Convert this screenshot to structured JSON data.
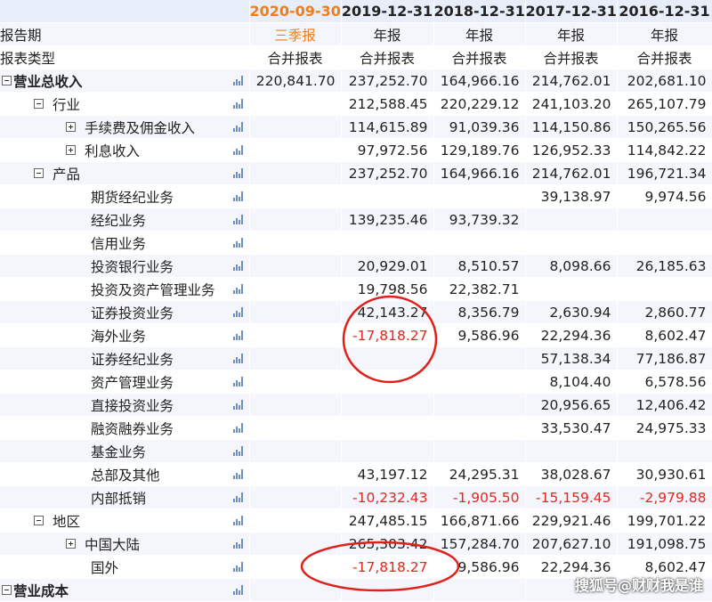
{
  "header": {
    "dates": [
      "2020-09-30",
      "2019-12-31",
      "2018-12-31",
      "2017-12-31",
      "2016-12-31"
    ],
    "active_date": "2020-09-30"
  },
  "meta_rows": [
    {
      "label": "报告期",
      "values": [
        "三季报",
        "年报",
        "年报",
        "年报",
        "年报"
      ]
    },
    {
      "label": "报表类型",
      "values": [
        "合并报表",
        "合并报表",
        "合并报表",
        "合并报表",
        "合并报表"
      ]
    }
  ],
  "rows": [
    {
      "label": "营业总收入",
      "level": 0,
      "expander": "minus",
      "bold": true,
      "values": [
        "220,841.70",
        "237,252.70",
        "164,966.16",
        "214,762.01",
        "202,681.10"
      ]
    },
    {
      "label": "行业",
      "level": 1,
      "expander": "minus",
      "values": [
        "",
        "212,588.45",
        "220,229.12",
        "241,103.20",
        "265,107.79"
      ]
    },
    {
      "label": "手续费及佣金收入",
      "level": 2,
      "expander": "plus",
      "values": [
        "",
        "114,615.89",
        "91,039.36",
        "114,150.86",
        "150,265.56"
      ]
    },
    {
      "label": "利息收入",
      "level": 2,
      "expander": "plus",
      "values": [
        "",
        "97,972.56",
        "129,189.76",
        "126,952.33",
        "114,842.22"
      ]
    },
    {
      "label": "产品",
      "level": 1,
      "expander": "minus",
      "values": [
        "",
        "237,252.70",
        "164,966.16",
        "214,762.01",
        "196,721.34"
      ]
    },
    {
      "label": "期货经纪业务",
      "level": 3,
      "values": [
        "",
        "",
        "",
        "39,138.97",
        "9,974.56"
      ]
    },
    {
      "label": "经纪业务",
      "level": 3,
      "values": [
        "",
        "139,235.46",
        "93,739.32",
        "",
        ""
      ]
    },
    {
      "label": "信用业务",
      "level": 3,
      "values": [
        "",
        "",
        "",
        "",
        ""
      ]
    },
    {
      "label": "投资银行业务",
      "level": 3,
      "values": [
        "",
        "20,929.01",
        "8,510.57",
        "8,098.66",
        "26,185.63"
      ]
    },
    {
      "label": "投资及资产管理业务",
      "level": 3,
      "values": [
        "",
        "19,798.56",
        "22,382.71",
        "",
        ""
      ]
    },
    {
      "label": "证券投资业务",
      "level": 3,
      "values": [
        "",
        "42,143.27",
        "8,356.79",
        "2,630.94",
        "2,860.77"
      ]
    },
    {
      "label": "海外业务",
      "level": 3,
      "values": [
        "",
        "-17,818.27",
        "9,586.96",
        "22,294.36",
        "8,602.47"
      ]
    },
    {
      "label": "证券经纪业务",
      "level": 3,
      "values": [
        "",
        "",
        "",
        "57,138.34",
        "77,186.87"
      ]
    },
    {
      "label": "资产管理业务",
      "level": 3,
      "values": [
        "",
        "",
        "",
        "8,104.40",
        "6,578.56"
      ]
    },
    {
      "label": "直接投资业务",
      "level": 3,
      "values": [
        "",
        "",
        "",
        "20,956.65",
        "12,406.42"
      ]
    },
    {
      "label": "融资融券业务",
      "level": 3,
      "values": [
        "",
        "",
        "",
        "33,530.47",
        "24,975.33"
      ]
    },
    {
      "label": "基金业务",
      "level": 3,
      "values": [
        "",
        "",
        "",
        "",
        ""
      ]
    },
    {
      "label": "总部及其他",
      "level": 3,
      "values": [
        "",
        "43,197.12",
        "24,295.31",
        "38,028.67",
        "30,930.61"
      ]
    },
    {
      "label": "内部抵销",
      "level": 3,
      "values": [
        "",
        "-10,232.43",
        "-1,905.50",
        "-15,159.45",
        "-2,979.88"
      ]
    },
    {
      "label": "地区",
      "level": 1,
      "expander": "minus",
      "values": [
        "",
        "247,485.15",
        "166,871.66",
        "229,921.46",
        "199,701.22"
      ]
    },
    {
      "label": "中国大陆",
      "level": 2,
      "expander": "plus",
      "values": [
        "",
        "265,303.42",
        "157,284.70",
        "207,627.10",
        "191,098.75"
      ]
    },
    {
      "label": "国外",
      "level": 3,
      "values": [
        "",
        "-17,818.27",
        "9,586.96",
        "22,294.36",
        "8,602.47"
      ]
    },
    {
      "label": "营业成本",
      "level": 0,
      "expander": "minus",
      "bold": true,
      "values": [
        "",
        "",
        "",
        "",
        ""
      ]
    }
  ],
  "watermark": "搜狐号@财财我是谁",
  "colors": {
    "header_bg": "#e8eef9",
    "band_bg": "#f4f6fb",
    "accent_orange": "#f07d1a",
    "negative_red": "#e8241c",
    "annotation_red": "#e0201a"
  }
}
